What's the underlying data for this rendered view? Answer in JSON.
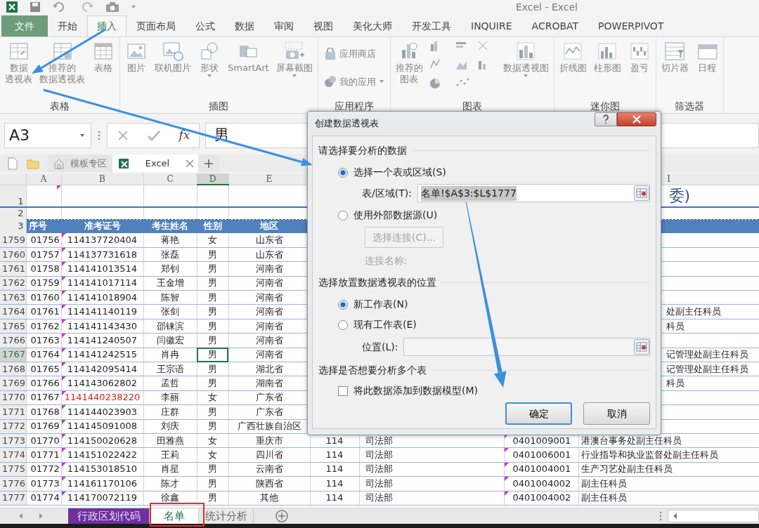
{
  "window": {
    "title": "Excel - Excel"
  },
  "ribbon": {
    "tabs": [
      {
        "label": "文件",
        "kind": "file",
        "selected": false
      },
      {
        "label": "开始",
        "kind": "tab",
        "selected": false
      },
      {
        "label": "插入",
        "kind": "tab",
        "selected": true
      },
      {
        "label": "页面布局",
        "kind": "tab",
        "selected": false
      },
      {
        "label": "公式",
        "kind": "tab",
        "selected": false
      },
      {
        "label": "数据",
        "kind": "tab",
        "selected": false
      },
      {
        "label": "审阅",
        "kind": "tab",
        "selected": false
      },
      {
        "label": "视图",
        "kind": "tab",
        "selected": false
      },
      {
        "label": "美化大师",
        "kind": "tab",
        "selected": false
      },
      {
        "label": "开发工具",
        "kind": "tab",
        "selected": false
      },
      {
        "label": "INQUIRE",
        "kind": "tab",
        "selected": false
      },
      {
        "label": "ACROBAT",
        "kind": "tab",
        "selected": false
      },
      {
        "label": "POWERPIVOT",
        "kind": "tab",
        "selected": false
      }
    ],
    "groups": [
      {
        "label": "表格",
        "items": [
          {
            "kind": "large",
            "lines": [
              "数据",
              "透视表"
            ]
          },
          {
            "kind": "large",
            "lines": [
              "推荐的",
              "数据透视表"
            ]
          },
          {
            "kind": "large",
            "lines": [
              "表格"
            ]
          }
        ]
      },
      {
        "label": "插图",
        "items": [
          {
            "kind": "large",
            "lines": [
              "图片"
            ]
          },
          {
            "kind": "large",
            "lines": [
              "联机图片"
            ]
          },
          {
            "kind": "large",
            "lines": [
              "形状"
            ],
            "dropdown": true
          },
          {
            "kind": "large",
            "lines": [
              "SmartArt"
            ]
          },
          {
            "kind": "large",
            "lines": [
              "屏幕截图"
            ],
            "dropdown": true
          }
        ]
      },
      {
        "label": "应用程序",
        "items": [
          {
            "kind": "small",
            "lines": [
              "应用商店"
            ]
          },
          {
            "kind": "small",
            "lines": [
              "我的应用"
            ],
            "dropdown": true
          }
        ]
      },
      {
        "label": "图表",
        "items": [
          {
            "kind": "large",
            "lines": [
              "推荐的",
              "图表"
            ]
          },
          {
            "kind": "gallery"
          },
          {
            "kind": "large",
            "lines": [
              "数据透视图"
            ],
            "dropdown": true
          }
        ]
      },
      {
        "label": "迷你图",
        "items": [
          {
            "kind": "large",
            "lines": [
              "折线图"
            ]
          },
          {
            "kind": "large",
            "lines": [
              "柱形图"
            ]
          },
          {
            "kind": "large",
            "lines": [
              "盈亏"
            ]
          }
        ]
      },
      {
        "label": "筛选器",
        "items": [
          {
            "kind": "large",
            "lines": [
              "切片器"
            ]
          },
          {
            "kind": "large",
            "lines": [
              "日程"
            ]
          }
        ]
      }
    ]
  },
  "formula_bar": {
    "name_box": "A3",
    "function_label": "fx",
    "formula": "男"
  },
  "browser_tabs": [
    {
      "label": "模板专区",
      "selected": false
    },
    {
      "label": "Excel",
      "selected": true
    }
  ],
  "sheet": {
    "column_headers": [
      {
        "label": "A",
        "selected": false
      },
      {
        "label": "B",
        "selected": false
      },
      {
        "label": "C",
        "selected": false
      },
      {
        "label": "D",
        "selected": true
      },
      {
        "label": "E",
        "selected": false
      },
      {
        "label": "I",
        "selected": false
      }
    ],
    "row_1": {
      "row": "1",
      "title": "委)"
    },
    "row_2": {
      "row": "2"
    },
    "row_3": {
      "row": "3",
      "cells": [
        "序号",
        "准考证号",
        "考生姓名",
        "性别",
        "地区"
      ]
    },
    "rows": [
      {
        "row": "1759",
        "cells": [
          "01756",
          "114137720404",
          "蒋艳",
          "女",
          "山东省"
        ],
        "selected": false,
        "error": false
      },
      {
        "row": "1760",
        "cells": [
          "01757",
          "114137731618",
          "张磊",
          "男",
          "山东省"
        ],
        "selected": false,
        "error": false
      },
      {
        "row": "1761",
        "cells": [
          "01758",
          "114141013514",
          "郑钊",
          "男",
          "河南省"
        ],
        "selected": false,
        "error": false
      },
      {
        "row": "1762",
        "cells": [
          "01759",
          "114141017114",
          "王金增",
          "男",
          "河南省"
        ],
        "selected": false,
        "error": false
      },
      {
        "row": "1763",
        "cells": [
          "01760",
          "114141018904",
          "陈智",
          "男",
          "河南省"
        ],
        "selected": false,
        "error": false
      },
      {
        "row": "1764",
        "cells": [
          "01761",
          "114141140119",
          "张剑",
          "男",
          "河南省"
        ],
        "tail": "处副主任科员",
        "selected": false,
        "error": false
      },
      {
        "row": "1765",
        "cells": [
          "01762",
          "114141143430",
          "邵铼滨",
          "男",
          "河南省"
        ],
        "tail": "科员",
        "selected": false,
        "error": false
      },
      {
        "row": "1766",
        "cells": [
          "01763",
          "114141240507",
          "闫徽宏",
          "男",
          "河南省"
        ],
        "selected": false,
        "error": false
      },
      {
        "row": "1767",
        "cells": [
          "01764",
          "114141242515",
          "肖冉",
          "男",
          "河南省"
        ],
        "tail": "记管理处副主任科员",
        "selected": true,
        "error": false
      },
      {
        "row": "1768",
        "cells": [
          "01765",
          "114142095414",
          "王宗语",
          "男",
          "湖北省"
        ],
        "tail": "记管理处副主任科员",
        "selected": false,
        "error": false
      },
      {
        "row": "1769",
        "cells": [
          "01766",
          "114143062802",
          "孟哲",
          "男",
          "湖南省"
        ],
        "tail": "科员",
        "selected": false,
        "error": false
      },
      {
        "row": "1770",
        "cells": [
          "01767",
          "1141440238220",
          "李丽",
          "女",
          "广东省"
        ],
        "selected": false,
        "error": true
      },
      {
        "row": "1771",
        "cells": [
          "01768",
          "114144023903",
          "庄群",
          "男",
          "广东省"
        ],
        "selected": false,
        "error": false
      },
      {
        "row": "1772",
        "cells": [
          "01769",
          "114145091008",
          "刘庆",
          "男",
          "广西壮族自治区"
        ],
        "selected": false,
        "error": false
      },
      {
        "row": "1773",
        "cells": [
          "01770",
          "114150020628",
          "田雅燕",
          "女",
          "重庆市"
        ],
        "right_cells": [
          "114",
          "司法部",
          "0401009001",
          "港澳台事务处副主任科员"
        ],
        "selected": false,
        "error": false
      },
      {
        "row": "1774",
        "cells": [
          "01771",
          "114151022422",
          "王莉",
          "女",
          "四川省"
        ],
        "right_cells": [
          "114",
          "司法部",
          "0401006001",
          "行业指导和执业监督处副主任科员"
        ],
        "selected": false,
        "error": false
      },
      {
        "row": "1775",
        "cells": [
          "01772",
          "114153018510",
          "肖星",
          "男",
          "云南省"
        ],
        "right_cells": [
          "114",
          "司法部",
          "0401004001",
          "生产习艺处副主任科员"
        ],
        "selected": false,
        "error": false
      },
      {
        "row": "1776",
        "cells": [
          "01773",
          "114161170106",
          "陈才",
          "男",
          "陕西省"
        ],
        "right_cells": [
          "114",
          "司法部",
          "0401004002",
          "副主任科员"
        ],
        "selected": false,
        "error": false
      },
      {
        "row": "1777",
        "cells": [
          "01774",
          "114170072119",
          "徐鑫",
          "男",
          "其他"
        ],
        "right_cells": [
          "114",
          "司法部",
          "0401004002",
          "副主任科员"
        ],
        "selected": false,
        "error": false
      }
    ]
  },
  "sheet_tabs": [
    {
      "label": "行政区划代码",
      "selected": false,
      "color": "#7030a0"
    },
    {
      "label": "名单",
      "selected": true
    },
    {
      "label": "统计分析",
      "selected": false
    }
  ],
  "dialog": {
    "title": "创建数据透视表",
    "source_heading": "请选择要分析的数据",
    "source_options": [
      {
        "label": "选择一个表或区域(S)",
        "selected": true
      },
      {
        "label": "使用外部数据源(U)",
        "selected": false
      }
    ],
    "range_label": "表/区域(T):",
    "range_value": "名单!$A$3:$L$1777",
    "connection_button": {
      "label": "选择连接(C)...",
      "disabled": true
    },
    "connection_name": {
      "label": "连接名称:",
      "disabled": true
    },
    "location_heading": "选择放置数据透视表的位置",
    "location_options": [
      {
        "label": "新工作表(N)",
        "selected": true
      },
      {
        "label": "现有工作表(E)",
        "selected": false
      }
    ],
    "location_label": "位置(L):",
    "multi_heading": "选择是否想要分析多个表",
    "data_model": {
      "label": "将此数据添加到数据模型(M)",
      "checked": false
    },
    "buttons": [
      "确定",
      "取消"
    ]
  }
}
